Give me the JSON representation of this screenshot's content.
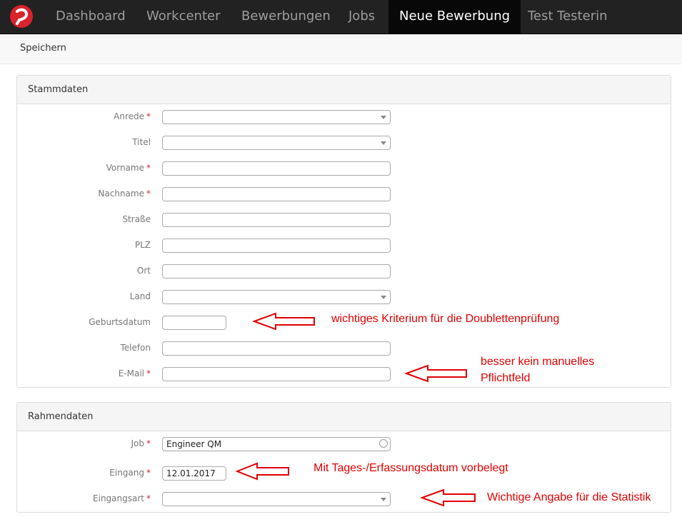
{
  "nav": {
    "items": [
      "Dashboard",
      "Workcenter",
      "Bewerbungen",
      "Jobs"
    ],
    "active": "Neue Bewerbung",
    "user": "Test Testerin"
  },
  "toolbar": {
    "save_label": "Speichern"
  },
  "required_marker": "*",
  "stammdaten": {
    "title": "Stammdaten",
    "fields": {
      "anrede": "Anrede",
      "titel": "Titel",
      "vorname": "Vorname",
      "nachname": "Nachname",
      "strasse": "Straße",
      "plz": "PLZ",
      "ort": "Ort",
      "land": "Land",
      "geburtsdatum": "Geburtsdatum",
      "telefon": "Telefon",
      "email": "E-Mail"
    }
  },
  "rahmendaten": {
    "title": "Rahmendaten",
    "job_label": "Job",
    "job_value": "Engineer QM",
    "eingang_label": "Eingang",
    "eingang_value": "12.01.2017",
    "eingangsart_label": "Eingangsart"
  },
  "annotations": {
    "geburtsdatum_note": "wichtiges Kriterium für die Doublettenprüfung",
    "email_note_line1": "besser kein manuelles",
    "email_note_line2": "Pflichtfeld",
    "eingang_note": "Mit Tages-/Erfassungsdatum vorbelegt",
    "eingangsart_note": "Wichtige Angabe für die Statistik",
    "color": "#e00000"
  },
  "colors": {
    "navbar": "#222222",
    "active_tab": "#080808",
    "logo": "#d9232d",
    "required": "#c9302c"
  }
}
